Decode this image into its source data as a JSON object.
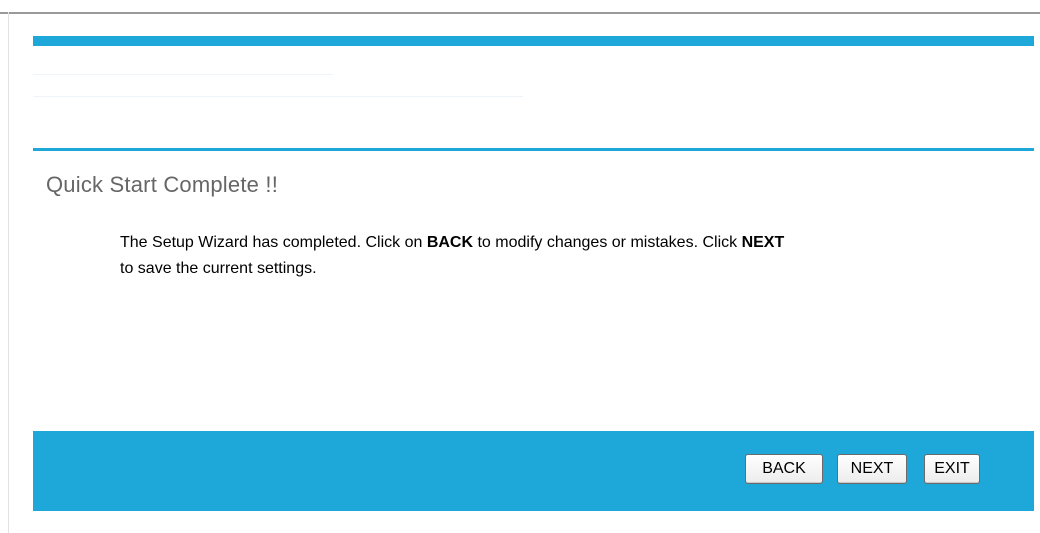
{
  "page": {
    "title": "Quick Start Complete !!",
    "message": {
      "part1": "The Setup Wizard has completed. Click on ",
      "back_word": "BACK",
      "part2": " to modify changes or mistakes. Click ",
      "next_word": "NEXT",
      "part3": "to save the current settings."
    }
  },
  "buttons": {
    "back_label": "BACK",
    "next_label": "NEXT",
    "exit_label": "EXIT"
  },
  "colors": {
    "accent_blue": "#1ea8d9",
    "title_gray": "#666666"
  }
}
